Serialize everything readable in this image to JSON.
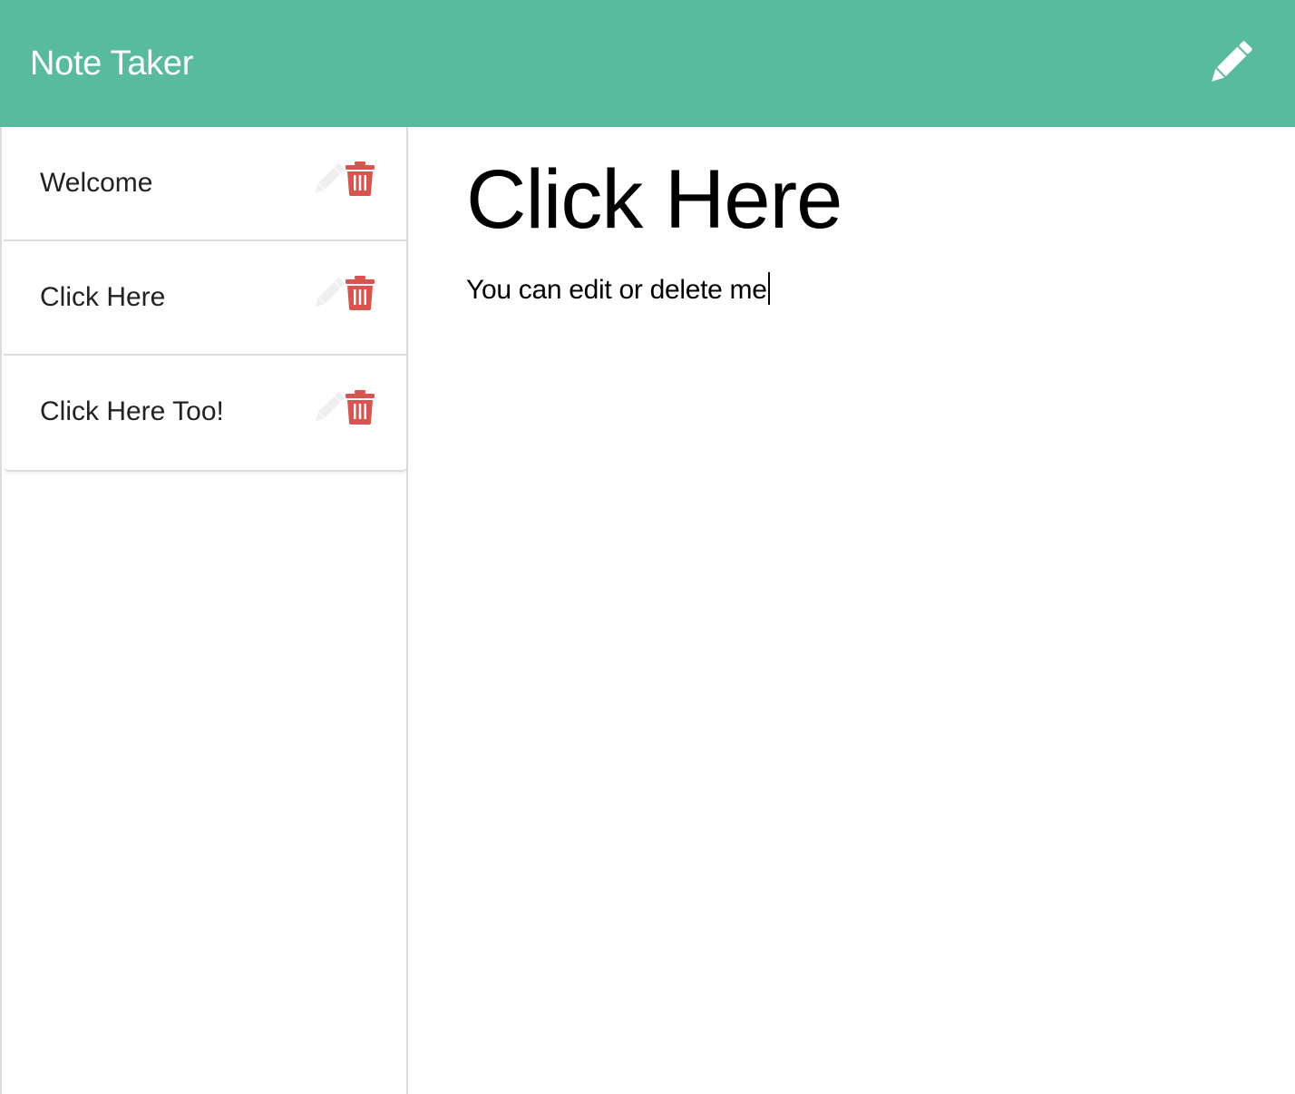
{
  "app": {
    "title": "Note Taker"
  },
  "header": {
    "new_note_icon": "pencil-icon"
  },
  "notes": [
    {
      "title": "Welcome",
      "edit_icon": "pencil-icon",
      "delete_icon": "trash-icon"
    },
    {
      "title": "Click Here",
      "edit_icon": "pencil-icon",
      "delete_icon": "trash-icon"
    },
    {
      "title": "Click Here Too!",
      "edit_icon": "pencil-icon",
      "delete_icon": "trash-icon"
    }
  ],
  "active_note": {
    "title": "Click Here",
    "text": "You can edit or delete me"
  },
  "colors": {
    "navbar": "#58bb9e",
    "delete_icon": "#d9534f",
    "edit_icon_muted": "#efefef"
  }
}
